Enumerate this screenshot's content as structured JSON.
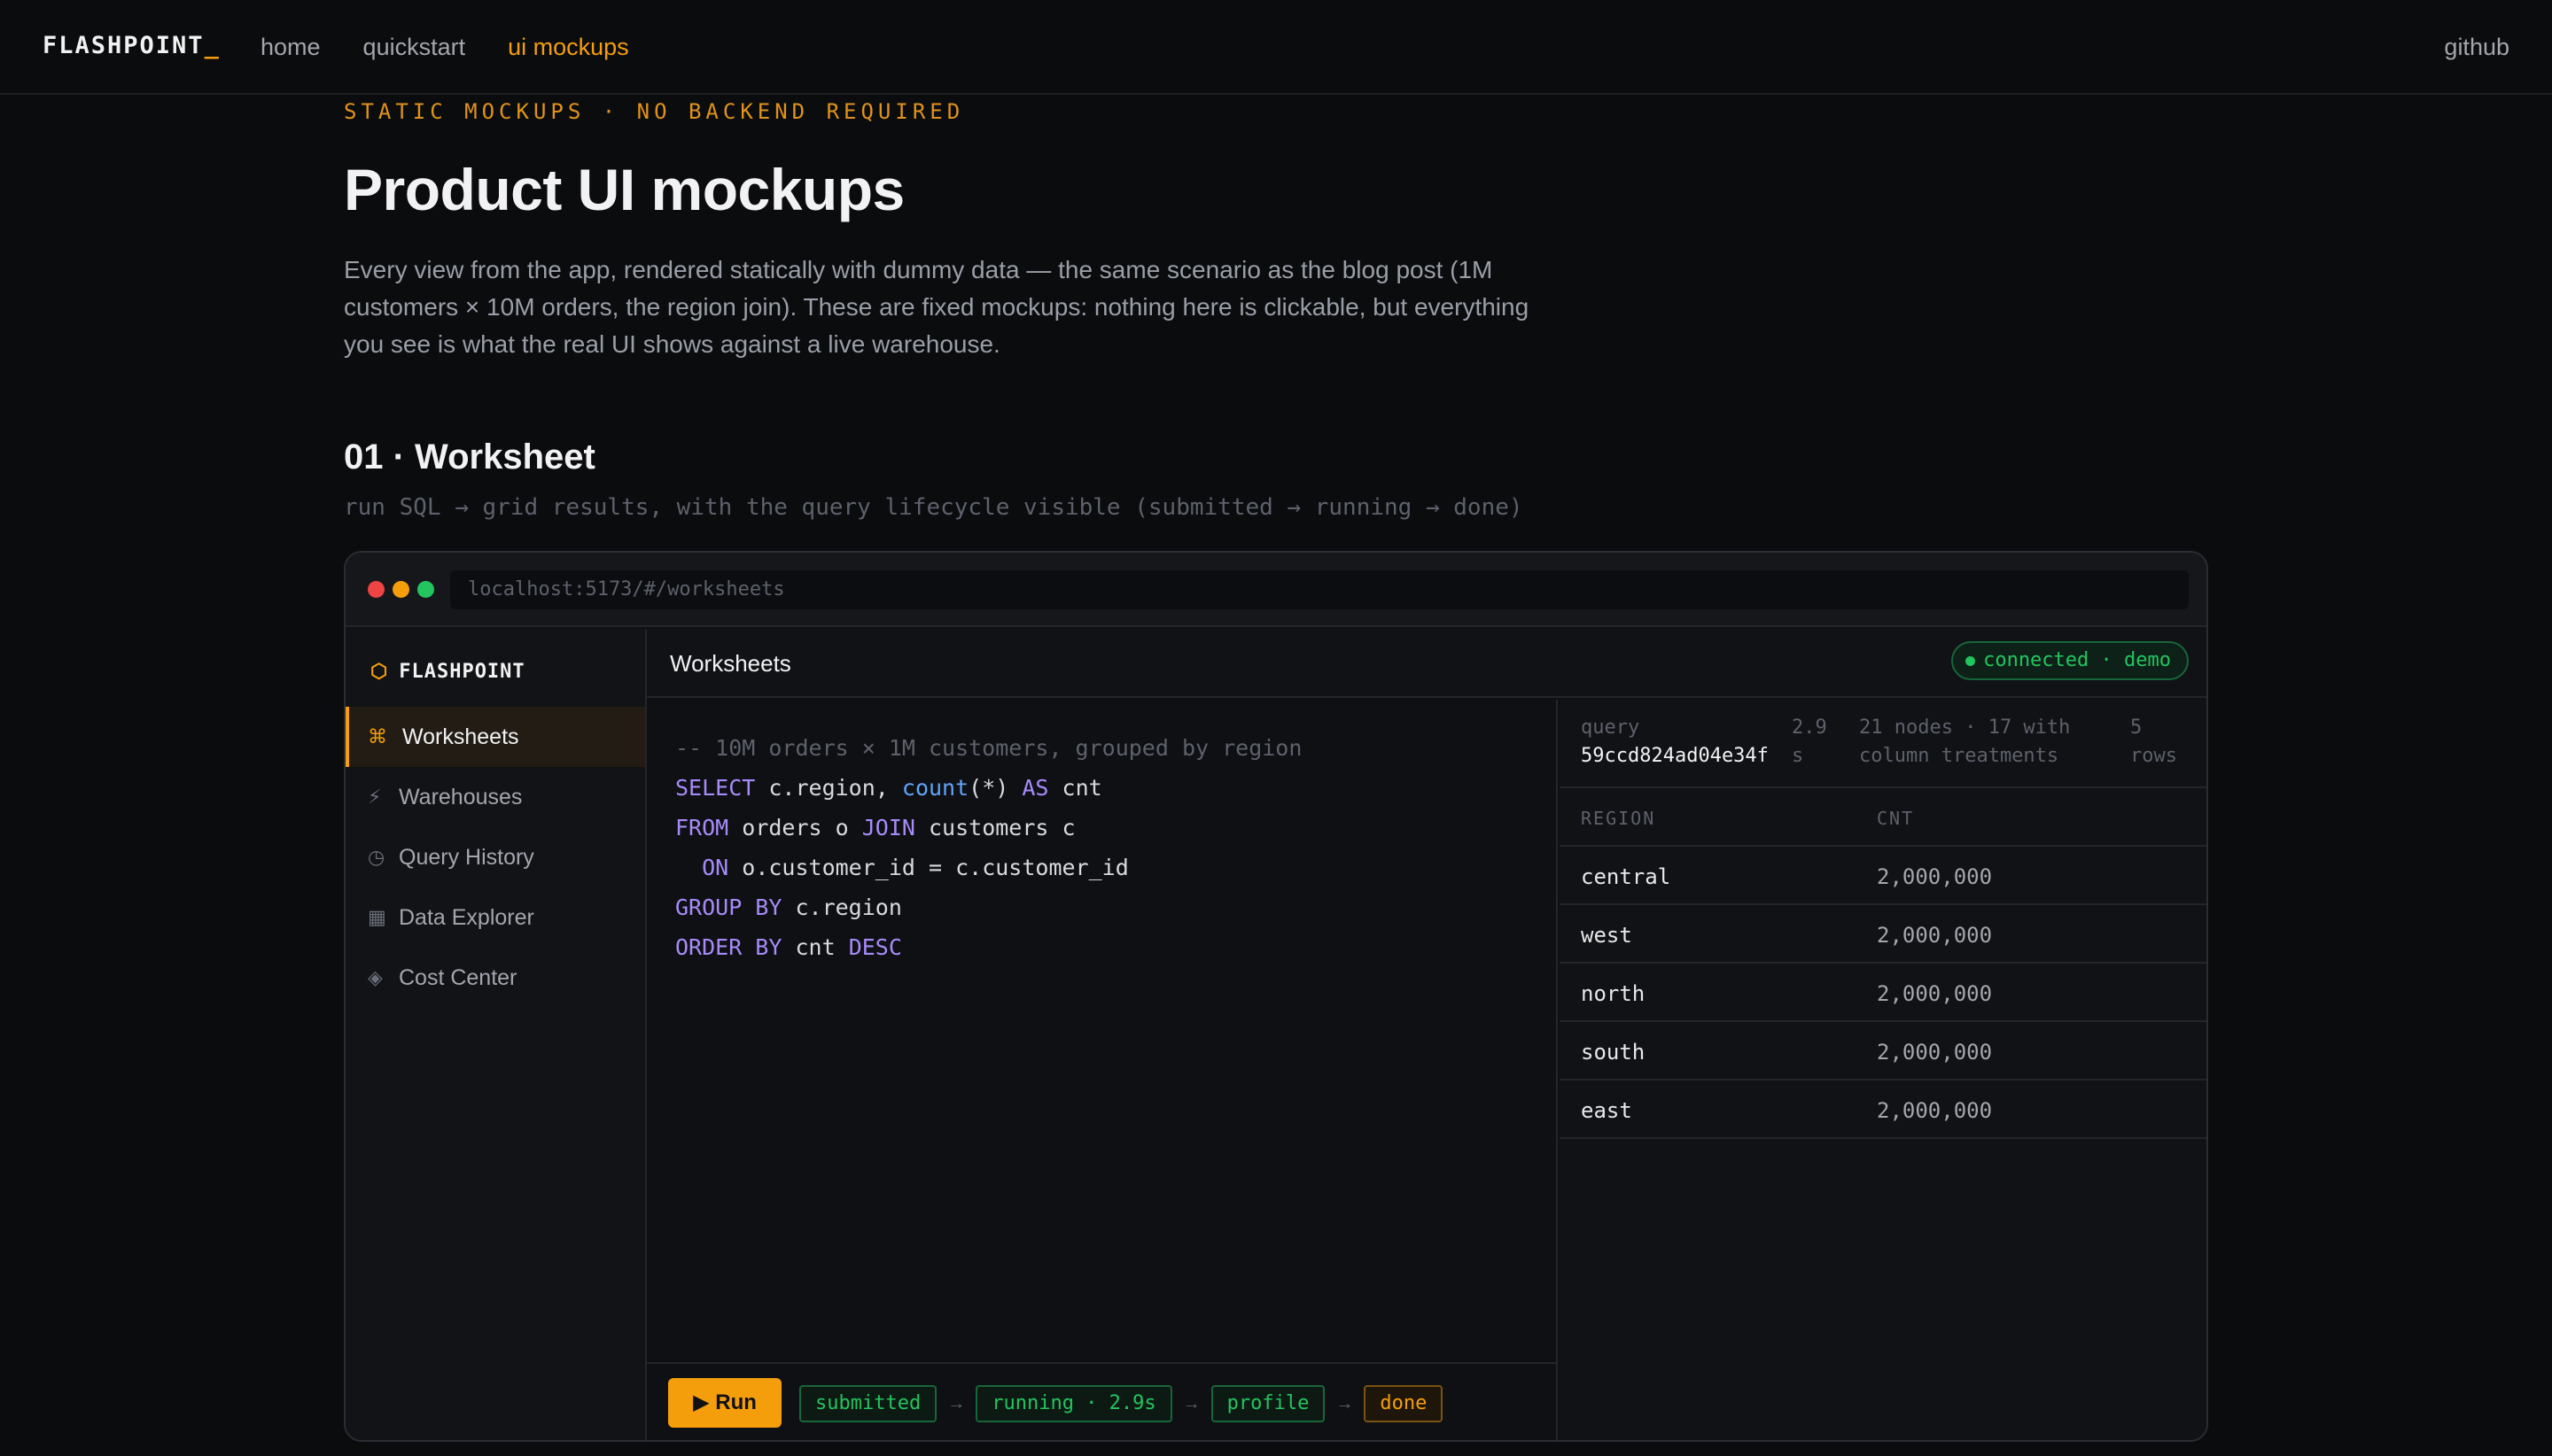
{
  "nav": {
    "brand": "FLASHPOINT",
    "brand_cursor": "_",
    "links": [
      "home",
      "quickstart",
      "ui mockups"
    ],
    "active_link": "ui mockups",
    "github": "github"
  },
  "page": {
    "eyebrow": "STATIC MOCKUPS · NO BACKEND REQUIRED",
    "title": "Product UI mockups",
    "lede": "Every view from the app, rendered statically with dummy data — the same scenario as the blog post (1M customers × 10M orders, the region join). These are fixed mockups: nothing here is clickable, but everything you see is what the real UI shows against a live warehouse."
  },
  "section": {
    "title": "01 · Worksheet",
    "subtitle": "run SQL → grid results, with the query lifecycle visible (submitted → running → done)"
  },
  "window": {
    "url": "localhost:5173/#/worksheets"
  },
  "app": {
    "brand_icon": "⬡",
    "brand": "FLASHPOINT",
    "sidebar": [
      {
        "icon": "⌘",
        "label": "Worksheets",
        "active": true
      },
      {
        "icon": "⚡",
        "label": "Warehouses"
      },
      {
        "icon": "◷",
        "label": "Query History"
      },
      {
        "icon": "▦",
        "label": "Data Explorer"
      },
      {
        "icon": "◈",
        "label": "Cost Center"
      }
    ],
    "header_title": "Worksheets",
    "connection": "connected · demo",
    "sql": {
      "comment": "-- 10M orders × 1M customers, grouped by region",
      "l2_kw1": "SELECT",
      "l2_a": " c.region, ",
      "l2_fn": "count",
      "l2_b": "(*) ",
      "l2_kw2": "AS",
      "l2_c": " cnt",
      "l3_kw1": "FROM",
      "l3_a": " orders o ",
      "l3_kw2": "JOIN",
      "l3_b": " customers c",
      "l4_pre": "  ",
      "l4_kw": "ON",
      "l4_a": " o.customer_id = c.customer_id",
      "l5_kw": "GROUP BY",
      "l5_a": " c.region",
      "l6_kw": "ORDER BY",
      "l6_a": " cnt ",
      "l6_kw2": "DESC"
    },
    "run_label": "▶ Run",
    "steps": [
      "submitted",
      "running · 2.9s",
      "profile",
      "done"
    ],
    "step_arrow": "→",
    "results": {
      "query_label": "query",
      "query_id": "59ccd824ad04e34f",
      "duration_1": "2.9",
      "duration_2": "s",
      "nodes_1": "21 nodes · 17 with",
      "nodes_2": "column treatments",
      "rows_1": "5",
      "rows_2": "rows",
      "columns": [
        "REGION",
        "CNT"
      ],
      "rows": [
        [
          "central",
          "2,000,000"
        ],
        [
          "west",
          "2,000,000"
        ],
        [
          "north",
          "2,000,000"
        ],
        [
          "south",
          "2,000,000"
        ],
        [
          "east",
          "2,000,000"
        ]
      ]
    }
  }
}
